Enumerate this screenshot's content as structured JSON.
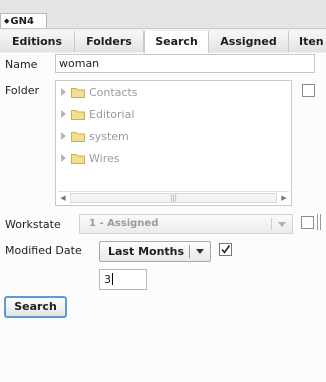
{
  "window": {
    "tab_title": "GN4"
  },
  "tabs": [
    {
      "label": "Editions",
      "active": false
    },
    {
      "label": "Folders",
      "active": false
    },
    {
      "label": "Search",
      "active": true
    },
    {
      "label": "Assigned",
      "active": false
    },
    {
      "label": "Iten",
      "active": false
    }
  ],
  "form": {
    "name_label": "Name",
    "name_value": "woman",
    "folder_label": "Folder",
    "folders": [
      "Contacts",
      "Editorial",
      "system",
      "Wires"
    ],
    "scroll_thumb": "|||",
    "workstate_label": "Workstate",
    "workstate_value": "1 - Assigned",
    "modified_date_label": "Modified Date",
    "modified_date_option": "Last Months",
    "modified_date_enabled": true,
    "modified_date_count": "3",
    "search_button": "Search"
  },
  "colors": {
    "button_focus": "#5a9ad8",
    "folder_icon": "#f2e08e",
    "disabled_text": "#9a9a9a"
  }
}
